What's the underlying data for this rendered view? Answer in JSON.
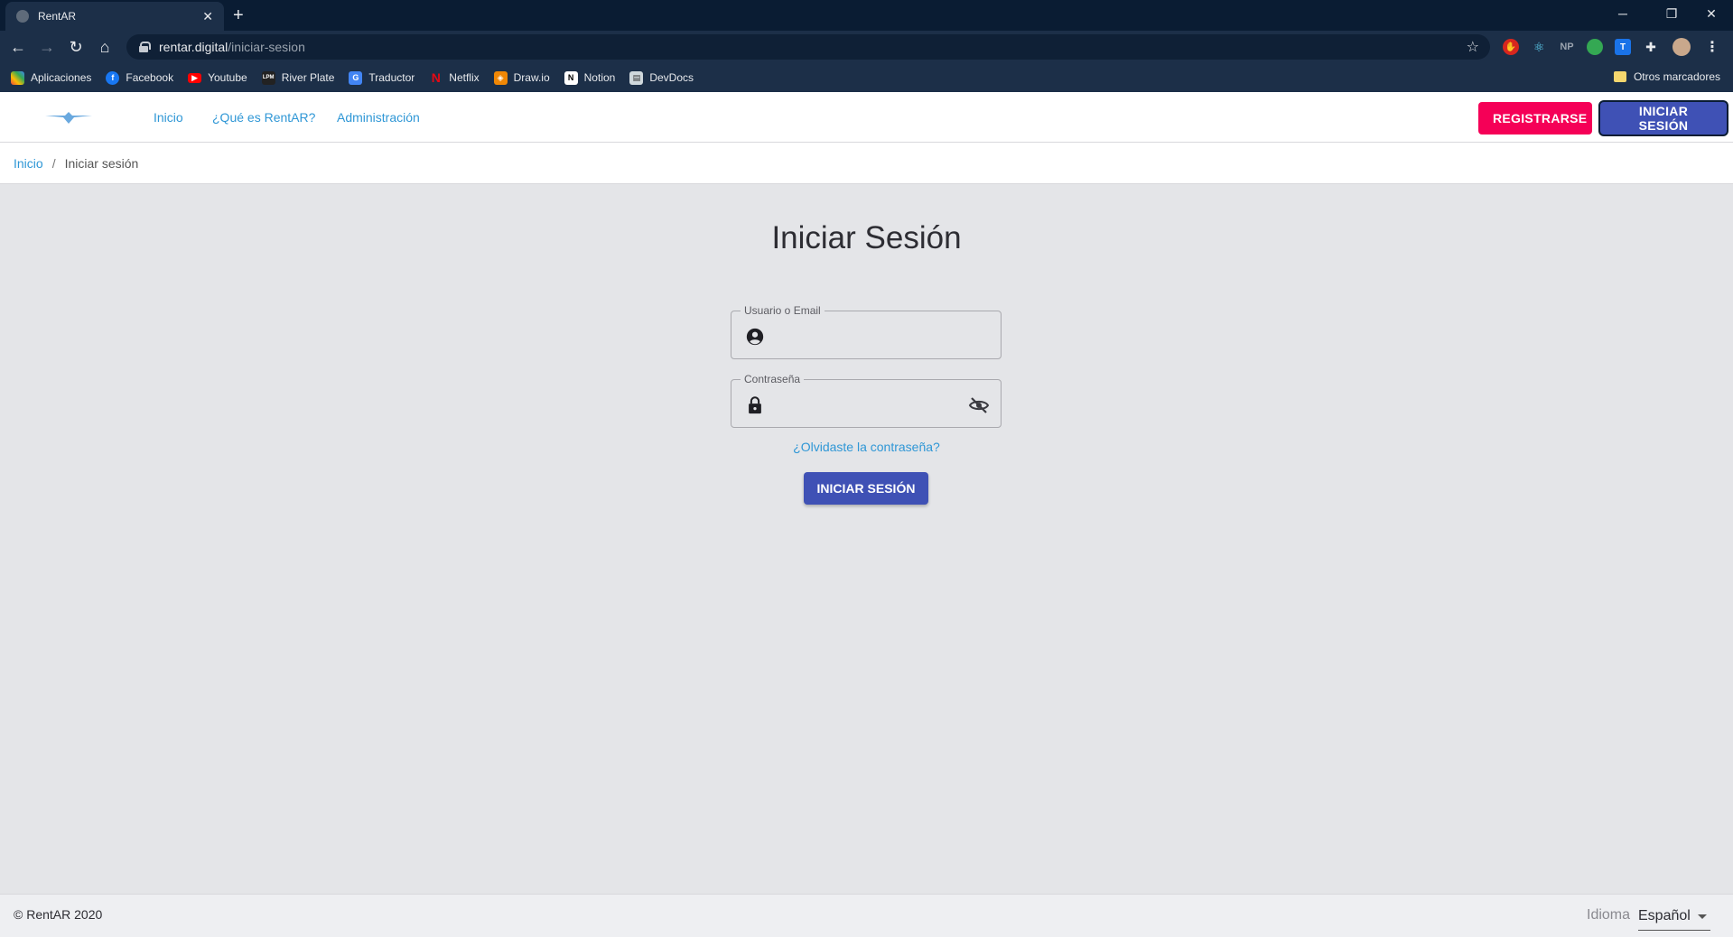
{
  "browser": {
    "tab_title": "RentAR",
    "tab_close": "✕",
    "new_tab": "+",
    "url_host": "rentar.digital",
    "url_path": "/iniciar-sesion",
    "bookmarks": [
      {
        "label": "Aplicaciones",
        "icon": "apps-grid-icon",
        "color": "#e8453c"
      },
      {
        "label": "Facebook",
        "icon": "facebook-icon",
        "color": "#1877f2"
      },
      {
        "label": "Youtube",
        "icon": "youtube-icon",
        "color": "#ff0000"
      },
      {
        "label": "River Plate",
        "icon": "river-plate-icon",
        "color": "#222222"
      },
      {
        "label": "Traductor",
        "icon": "translate-icon",
        "color": "#4285f4"
      },
      {
        "label": "Netflix",
        "icon": "netflix-icon",
        "color": "#e50914"
      },
      {
        "label": "Draw.io",
        "icon": "drawio-icon",
        "color": "#f08705"
      },
      {
        "label": "Notion",
        "icon": "notion-icon",
        "color": "#ffffff"
      },
      {
        "label": "DevDocs",
        "icon": "devdocs-icon",
        "color": "#cfd8dc"
      }
    ],
    "other_bookmarks": "Otros marcadores"
  },
  "header": {
    "nav": [
      {
        "label": "Inicio"
      },
      {
        "label": "¿Qué es RentAR?"
      },
      {
        "label": "Administración"
      }
    ],
    "register_label": "REGISTRARSE",
    "login_label": "INICIAR SESIÓN"
  },
  "breadcrumb": {
    "home": "Inicio",
    "separator": "/",
    "current": "Iniciar sesión"
  },
  "login": {
    "title": "Iniciar Sesión",
    "username_label": "Usuario o Email",
    "username_value": "",
    "password_label": "Contraseña",
    "password_value": "",
    "forgot_label": "¿Olvidaste la contraseña?",
    "submit_label": "INICIAR SESIÓN"
  },
  "footer": {
    "copyright": "© RentAR 2020",
    "language_label": "Idioma",
    "language_value": "Español"
  },
  "colors": {
    "primary": "#3f51b5",
    "secondary": "#f50057",
    "link": "#2f97d6"
  }
}
